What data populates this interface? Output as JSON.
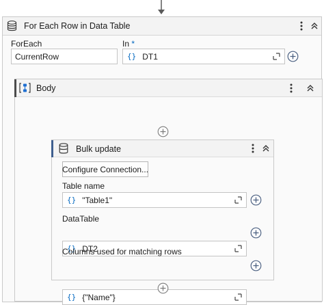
{
  "foreach": {
    "title": "For Each Row in Data Table",
    "foreach_label": "ForEach",
    "foreach_value": "CurrentRow",
    "in_label": "In",
    "in_required_mark": "*",
    "in_value": "DT1",
    "braces": "{}"
  },
  "body": {
    "title": "Body"
  },
  "bulk": {
    "title": "Bulk update",
    "configure_label": "Configure Connection...",
    "table_name_label": "Table name",
    "table_name_value": "\"Table1\"",
    "datatable_label": "DataTable",
    "datatable_value": "DT2",
    "columns_label": "Columns used for matching rows",
    "columns_value": "{\"Name\"}",
    "braces": "{}"
  },
  "icons": {
    "activity": "database-stack-icon",
    "body": "sequence-body-icon",
    "bulk": "database-icon",
    "menu": "kebab-menu-icon",
    "collapse": "collapse-chevrons-icon",
    "expand": "expand-editor-icon",
    "add": "add-circle-icon"
  },
  "colors": {
    "accent": "#0067c0",
    "header_bg": "#f3f3f3",
    "card_bg": "#fafafa",
    "border": "#c9c9c9"
  }
}
